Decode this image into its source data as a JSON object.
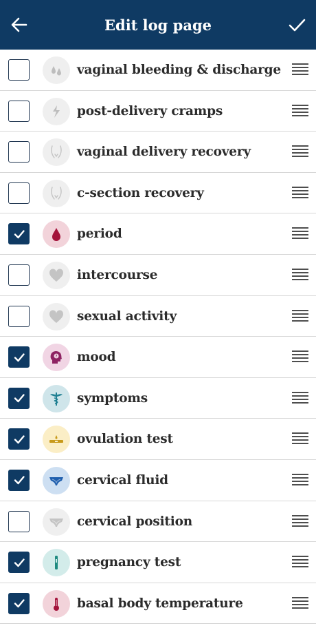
{
  "header": {
    "title": "Edit log page",
    "bg_color": "#0f3a63"
  },
  "items": [
    {
      "label": "vaginal bleeding & discharge",
      "checked": false,
      "icon": "drops-icon",
      "icon_bg": "#efefef",
      "icon_color": "#bdbdbd"
    },
    {
      "label": "post-delivery cramps",
      "checked": false,
      "icon": "lightning-icon",
      "icon_bg": "#efefef",
      "icon_color": "#bdbdbd"
    },
    {
      "label": "vaginal delivery recovery",
      "checked": false,
      "icon": "pelvis-icon",
      "icon_bg": "#efefef",
      "icon_color": "#c4c4c4"
    },
    {
      "label": "c-section recovery",
      "checked": false,
      "icon": "pelvis-icon",
      "icon_bg": "#efefef",
      "icon_color": "#c4c4c4"
    },
    {
      "label": "period",
      "checked": true,
      "icon": "blood-drop-icon",
      "icon_bg": "#f2d3da",
      "icon_color": "#a3123a"
    },
    {
      "label": "intercourse",
      "checked": false,
      "icon": "heart-icon",
      "icon_bg": "#efefef",
      "icon_color": "#c4c4c4"
    },
    {
      "label": "sexual activity",
      "checked": false,
      "icon": "heart-icon",
      "icon_bg": "#efefef",
      "icon_color": "#c4c4c4"
    },
    {
      "label": "mood",
      "checked": true,
      "icon": "head-icon",
      "icon_bg": "#f1d5e4",
      "icon_color": "#8e2262"
    },
    {
      "label": "symptoms",
      "checked": true,
      "icon": "caduceus-icon",
      "icon_bg": "#cfe5ea",
      "icon_color": "#1f7f92"
    },
    {
      "label": "ovulation test",
      "checked": true,
      "icon": "ovulation-test-icon",
      "icon_bg": "#fbeec6",
      "icon_color": "#c89a1b"
    },
    {
      "label": "cervical fluid",
      "checked": true,
      "icon": "underwear-icon",
      "icon_bg": "#cddff2",
      "icon_color": "#1f5fae"
    },
    {
      "label": "cervical position",
      "checked": false,
      "icon": "underwear-icon",
      "icon_bg": "#efefef",
      "icon_color": "#c4c4c4"
    },
    {
      "label": "pregnancy test",
      "checked": true,
      "icon": "pregnancy-test-icon",
      "icon_bg": "#d3ecea",
      "icon_color": "#1f8a7f"
    },
    {
      "label": "basal body temperature",
      "checked": true,
      "icon": "thermometer-icon",
      "icon_bg": "#f2d3da",
      "icon_color": "#a3123a"
    }
  ]
}
